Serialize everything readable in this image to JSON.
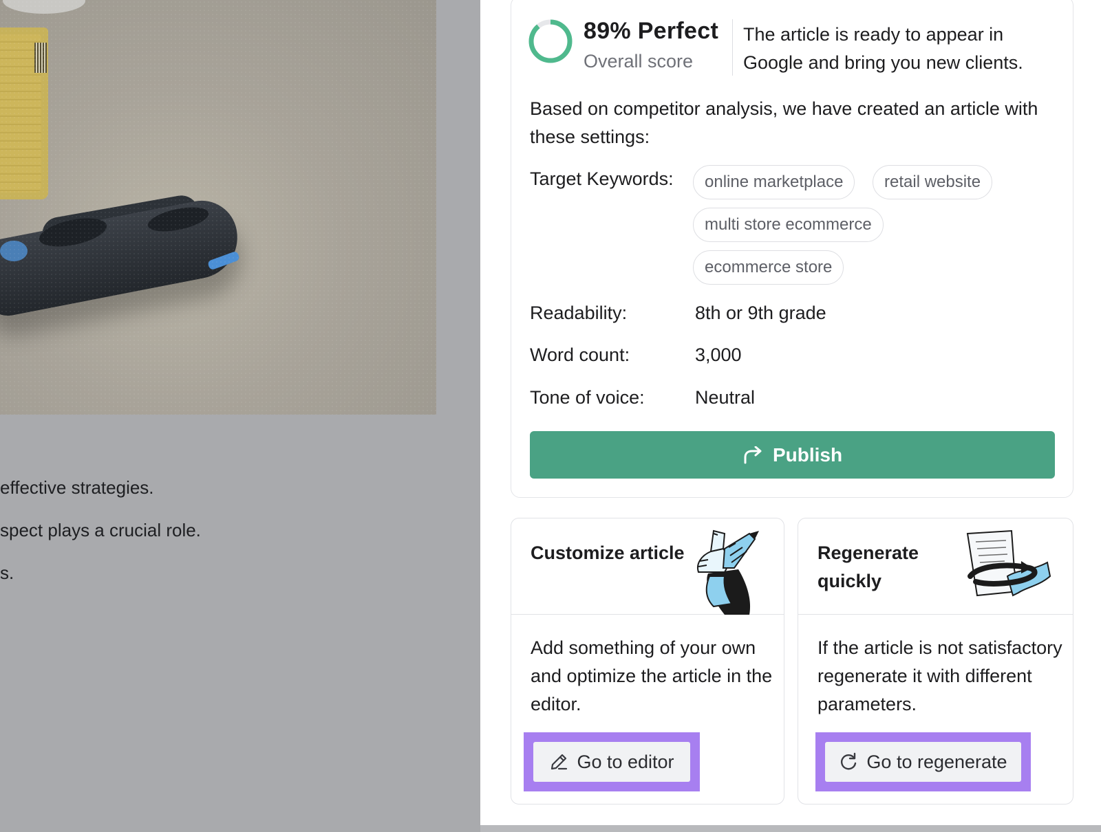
{
  "background_article": {
    "lines": [
      "effective strategies.",
      "spect plays a crucial role.",
      "s."
    ]
  },
  "score": {
    "title": "89% Perfect",
    "subtitle": "Overall score",
    "percent": 89,
    "ring_color": "#4fb98d",
    "message": "The article is ready to appear in Google and bring you new clients."
  },
  "intro": "Based on competitor analysis, we have created an article with these settings:",
  "settings": {
    "keywords_label": "Target Keywords:",
    "keywords": [
      "online marketplace",
      "retail website",
      "multi store ecommerce",
      "ecommerce store"
    ],
    "readability_label": "Readability:",
    "readability_value": "8th or 9th grade",
    "word_count_label": "Word count:",
    "word_count_value": "3,000",
    "tone_label": "Tone of voice:",
    "tone_value": "Neutral"
  },
  "publish": {
    "label": "Publish",
    "color": "#4aa284",
    "icon": "share-arrow-icon"
  },
  "customize": {
    "title": "Customize article",
    "description": "Add something of your own and optimize the article in the editor.",
    "button_label": "Go to editor",
    "button_icon": "pencil-icon"
  },
  "regenerate": {
    "title": "Regenerate quickly",
    "description": "If the article is not satisfactory regenerate it with different parameters.",
    "button_label": "Go to regenerate",
    "button_icon": "refresh-icon"
  },
  "highlight_color": "#a77ff0"
}
